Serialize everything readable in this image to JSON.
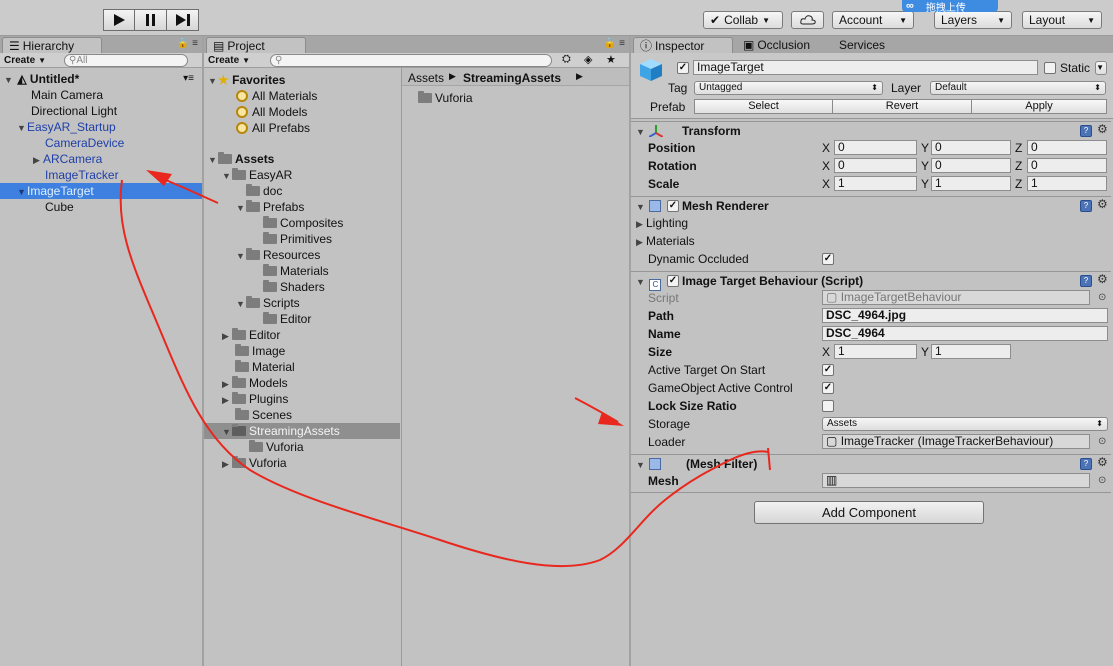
{
  "toolbar": {
    "collab_label": "Collab",
    "account_label": "Account",
    "layers_label": "Layers",
    "layout_label": "Layout",
    "upload_badge_text": "拖拽上传"
  },
  "hierarchy": {
    "tab_label": "Hierarchy",
    "create_label": "Create",
    "search_placeholder": "All",
    "scene_name": "Untitled*",
    "items": [
      {
        "label": "Main Camera"
      },
      {
        "label": "Directional Light"
      },
      {
        "label": "EasyAR_Startup"
      },
      {
        "label": "CameraDevice"
      },
      {
        "label": "ARCamera"
      },
      {
        "label": "ImageTracker"
      },
      {
        "label": "ImageTarget"
      },
      {
        "label": "Cube"
      }
    ]
  },
  "project": {
    "tab_label": "Project",
    "create_label": "Create",
    "favorites_label": "Favorites",
    "favorites": [
      "All Materials",
      "All Models",
      "All Prefabs"
    ],
    "assets_label": "Assets",
    "tree": [
      "EasyAR",
      "doc",
      "Prefabs",
      "Composites",
      "Primitives",
      "Resources",
      "Materials",
      "Shaders",
      "Scripts",
      "Editor",
      "Editor",
      "Image",
      "Material",
      "Models",
      "Plugins",
      "Scenes",
      "StreamingAssets",
      "Vuforia",
      "Vuforia"
    ],
    "breadcrumb": [
      "Assets",
      "StreamingAssets"
    ],
    "contents": [
      "Vuforia"
    ]
  },
  "inspector": {
    "tabs": [
      "Inspector",
      "Occlusion",
      "Services"
    ],
    "object_name": "ImageTarget",
    "static_label": "Static",
    "tag_label": "Tag",
    "tag_value": "Untagged",
    "layer_label": "Layer",
    "layer_value": "Default",
    "prefab_label": "Prefab",
    "prefab_buttons": [
      "Select",
      "Revert",
      "Apply"
    ],
    "transform": {
      "title": "Transform",
      "rows": [
        {
          "label": "Position",
          "x": "0",
          "y": "0",
          "z": "0"
        },
        {
          "label": "Rotation",
          "x": "0",
          "y": "0",
          "z": "0"
        },
        {
          "label": "Scale",
          "x": "1",
          "y": "1",
          "z": "1"
        }
      ]
    },
    "mesh_renderer": {
      "title": "Mesh Renderer",
      "lighting": "Lighting",
      "materials": "Materials",
      "dynamic_occluded": "Dynamic Occluded"
    },
    "image_target": {
      "title": "Image Target Behaviour (Script)",
      "script_label": "Script",
      "script_value": "ImageTargetBehaviour",
      "path_label": "Path",
      "path_value": "DSC_4964.jpg",
      "name_label": "Name",
      "name_value": "DSC_4964",
      "size_label": "Size",
      "size_x": "1",
      "size_y": "1",
      "active_label": "Active Target On Start",
      "gameobject_label": "GameObject Active Control",
      "lock_label": "Lock Size Ratio",
      "storage_label": "Storage",
      "storage_value": "Assets",
      "loader_label": "Loader",
      "loader_value": "ImageTracker (ImageTrackerBehaviour)"
    },
    "mesh_filter": {
      "title": "(Mesh Filter)",
      "mesh_label": "Mesh"
    },
    "add_component_label": "Add Component"
  },
  "colors": {
    "selection": "#3d80df",
    "annotation": "#e8281e",
    "prefab_text": "#1f3fa8"
  }
}
